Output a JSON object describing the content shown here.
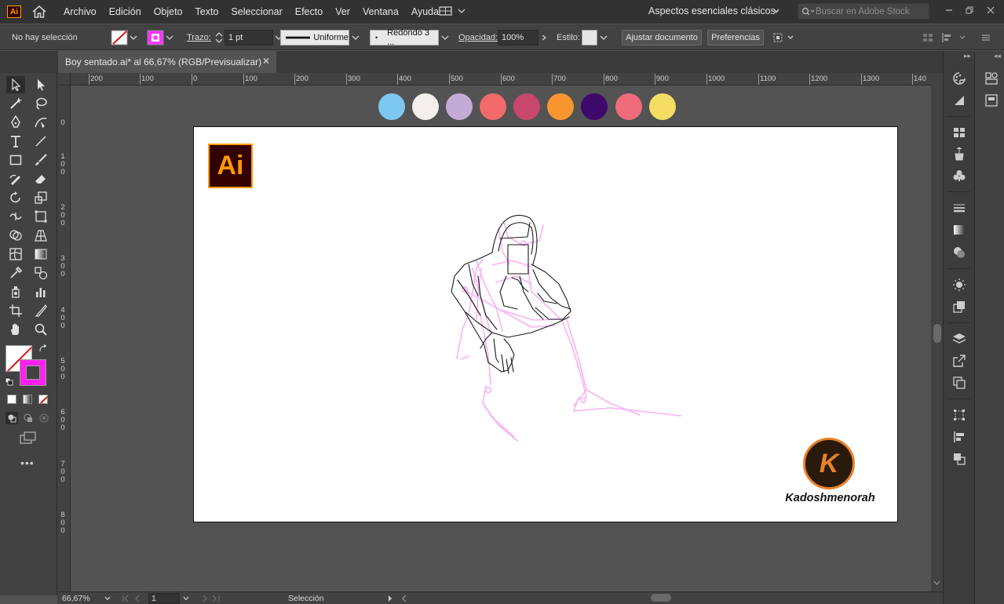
{
  "app": {
    "logo_text": "Ai"
  },
  "menu": {
    "items": [
      "Archivo",
      "Edición",
      "Objeto",
      "Texto",
      "Seleccionar",
      "Efecto",
      "Ver",
      "Ventana",
      "Ayuda"
    ],
    "workspace": "Aspectos esenciales clásicos",
    "search_placeholder": "Buscar en Adobe Stock"
  },
  "control": {
    "selection_status": "No hay selección",
    "stroke_label": "Trazo:",
    "stroke_weight": "1 pt",
    "profile": "Uniforme",
    "brush": "Redondo 3 ...",
    "opacity_label": "Opacidad:",
    "opacity_value": "100%",
    "style_label": "Estilo:",
    "fit_document": "Ajustar documento",
    "preferences": "Preferencias",
    "fill_color": "#ff33ff"
  },
  "document": {
    "tab_title": "Boy sentado.ai* al 66,67% (RGB/Previsualizar)"
  },
  "rulers": {
    "horizontal": [
      "200",
      "100",
      "0",
      "100",
      "200",
      "300",
      "400",
      "500",
      "600",
      "700",
      "800",
      "900",
      "1000",
      "1100",
      "1200",
      "1300",
      "140"
    ],
    "vertical": [
      "0",
      "100",
      "200",
      "300",
      "400",
      "500",
      "600",
      "700",
      "800"
    ]
  },
  "swatches": [
    "#7cc8f2",
    "#f3f0eb",
    "#c4abd6",
    "#f26a6a",
    "#c7476d",
    "#f7962f",
    "#3d0a6b",
    "#f06b7b",
    "#f5dd63"
  ],
  "artboard": {
    "logo_letter": "K",
    "brand_name": "Kadoshmenorah",
    "brand_color": "#e8812a"
  },
  "status": {
    "zoom": "66,67%",
    "artboard_number": "1",
    "tool": "Selección"
  }
}
